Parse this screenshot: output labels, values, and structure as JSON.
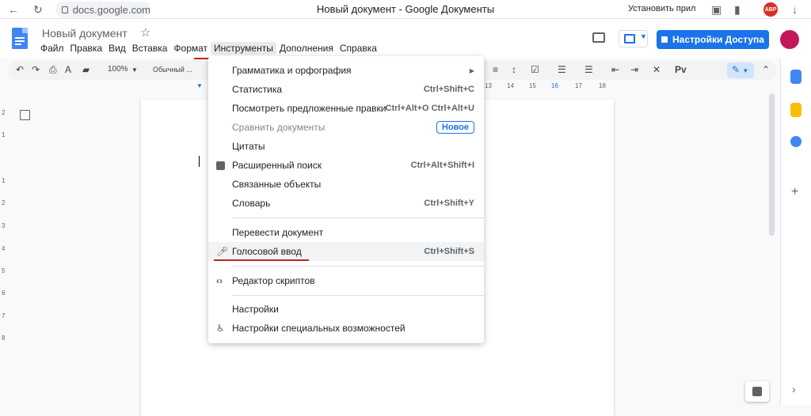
{
  "browser": {
    "url": "docs.google.com",
    "window_title": "Новый документ - Google Документы",
    "install_label": "Установить прил",
    "abp_label": "ABP"
  },
  "docs": {
    "title": "Новый документ",
    "share_label": "Настройки Доступа",
    "menu": [
      "Файл",
      "Правка",
      "Вид",
      "Вставка",
      "Формат",
      "Инструменты",
      "Дополнения",
      "Справка"
    ],
    "active_menu": "Инструменты"
  },
  "toolbar": {
    "zoom": "100%",
    "style": "Обычный ..."
  },
  "ruler": {
    "h": [
      "13",
      "14",
      "15",
      "16",
      "17",
      "18"
    ],
    "v": [
      "2",
      "1",
      "1",
      "2",
      "3",
      "4",
      "5",
      "6",
      "7",
      "8"
    ]
  },
  "tools_menu": {
    "items": [
      {
        "label": "Грамматика и орфография",
        "submenu": true
      },
      {
        "label": "Статистика",
        "shortcut": "Ctrl+Shift+C"
      },
      {
        "label": "Посмотреть предложенные правки",
        "shortcut": "Ctrl+Alt+O Ctrl+Alt+U"
      },
      {
        "label": "Сравнить документы",
        "disabled": true,
        "badge": "Новое"
      },
      {
        "label": "Цитаты"
      },
      {
        "label": "Расширенный поиск",
        "shortcut": "Ctrl+Alt+Shift+I",
        "icon": "explore-icon"
      },
      {
        "label": "Связанные объекты"
      },
      {
        "label": "Словарь",
        "shortcut": "Ctrl+Shift+Y"
      },
      {
        "label": "Перевести документ"
      },
      {
        "label": "Голосовой ввод",
        "shortcut": "Ctrl+Shift+S",
        "icon": "microphone-icon",
        "highlighted": true
      },
      {
        "label": "Редактор скриптов",
        "icon": "code-icon"
      },
      {
        "label": "Настройки"
      },
      {
        "label": "Настройки специальных возможностей",
        "icon": "accessibility-icon"
      }
    ]
  },
  "colors": {
    "accent": "#1a73e8",
    "annotation_red": "#c5221f",
    "avatar": "#c2185b"
  }
}
